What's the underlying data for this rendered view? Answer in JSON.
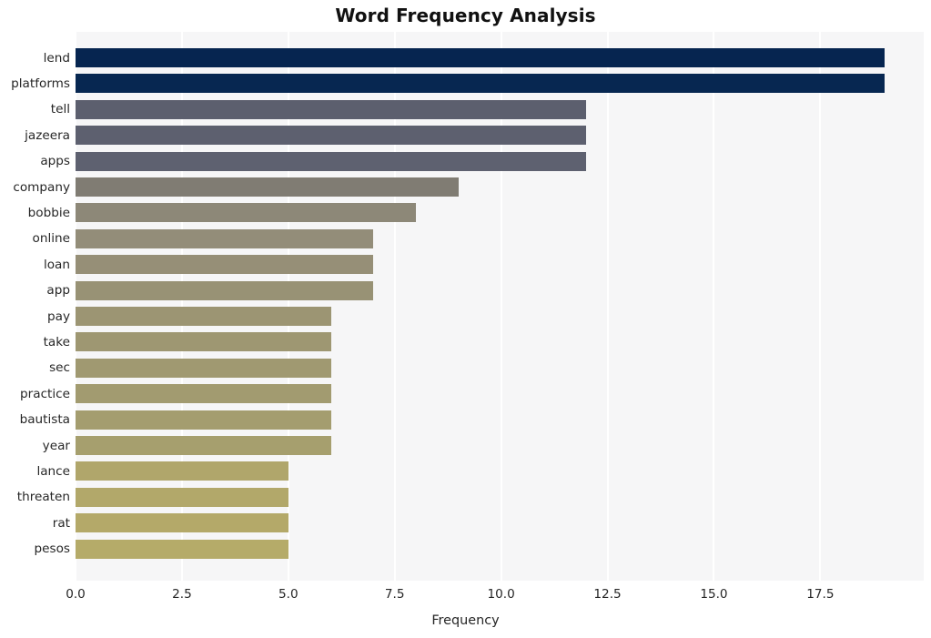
{
  "chart_data": {
    "type": "bar",
    "orientation": "horizontal",
    "title": "Word Frequency Analysis",
    "xlabel": "Frequency",
    "ylabel": "",
    "categories": [
      "lend",
      "platforms",
      "tell",
      "jazeera",
      "apps",
      "company",
      "bobbie",
      "online",
      "loan",
      "app",
      "pay",
      "take",
      "sec",
      "practice",
      "bautista",
      "year",
      "lance",
      "threaten",
      "rat",
      "pesos"
    ],
    "values": [
      19,
      19,
      12,
      12,
      12,
      9,
      8,
      7,
      7,
      7,
      6,
      6,
      6,
      6,
      6,
      6,
      5,
      5,
      5,
      5
    ],
    "bar_colors": [
      "#062550",
      "#072751",
      "#5c5f6e",
      "#5d606f",
      "#5e6170",
      "#807c73",
      "#8d8878",
      "#938d79",
      "#968f77",
      "#989275",
      "#9c9573",
      "#9e9772",
      "#a09971",
      "#a29b70",
      "#a49d6f",
      "#a69f6e",
      "#b0a66b",
      "#b2a86a",
      "#b4a969",
      "#b5ab69"
    ],
    "x_ticks": [
      0.0,
      2.5,
      5.0,
      7.5,
      10.0,
      12.5,
      15.0,
      17.5
    ],
    "x_tick_labels": [
      "0.0",
      "2.5",
      "5.0",
      "7.5",
      "10.0",
      "12.5",
      "15.0",
      "17.5"
    ],
    "xlim": [
      0,
      19.93
    ],
    "grid": "vertical",
    "legend": null,
    "plot_background": "#f6f6f7",
    "figure_background": "#ffffff",
    "gridline_color": "#ffffff"
  }
}
